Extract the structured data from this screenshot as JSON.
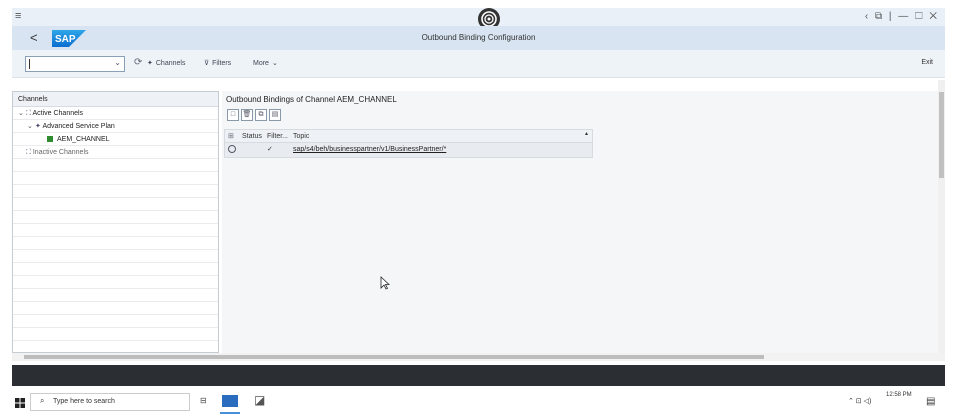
{
  "window": {
    "menu_icon": "hamburger-icon",
    "logo_icon": "app-logo-icon",
    "controls": "‹  ⧉  |  —  ☐  ✕"
  },
  "header": {
    "back_label": "<",
    "logo_text": "SAP",
    "title": "Outbound Binding Configuration",
    "brand_color": "#0a6ed1"
  },
  "toolbar": {
    "command_value": "",
    "refresh_icon": "refresh-icon",
    "channels_label": "Channels",
    "filters_label": "Filters",
    "more_label": "More",
    "exit_label": "Exit"
  },
  "left_panel": {
    "header": "Channels",
    "tree": [
      {
        "label": "Active Channels",
        "level": 0,
        "expanded": true,
        "icon": "channels-icon"
      },
      {
        "label": "Advanced Service Plan",
        "level": 1,
        "expanded": true,
        "icon": "service-plan-icon"
      },
      {
        "label": "AEM_CHANNEL",
        "level": 2,
        "icon": "green-square-icon"
      },
      {
        "label": "Inactive Channels",
        "level": 0,
        "expanded": false,
        "icon": "channels-icon"
      }
    ]
  },
  "right_panel": {
    "title": "Outbound Bindings of Channel AEM_CHANNEL",
    "buttons": [
      "create-icon",
      "delete-icon",
      "copy-icon",
      "details-icon"
    ],
    "table": {
      "columns": [
        "Status",
        "Filter...",
        "Topic"
      ],
      "rows": [
        {
          "selected": false,
          "status": "",
          "filter": "✓",
          "topic": "sap/s4/beh/businesspartner/v1/BusinessPartner/*"
        }
      ]
    }
  },
  "taskbar": {
    "search_placeholder": "Type here to search",
    "time": "12:58 PM",
    "date": ""
  }
}
